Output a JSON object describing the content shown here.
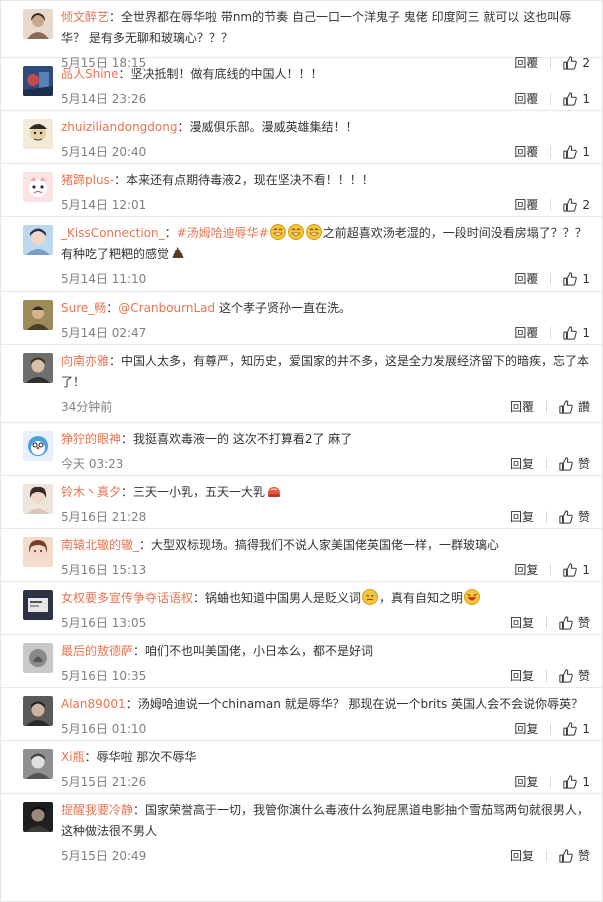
{
  "comments": [
    {
      "user": "倾文醉艺",
      "text": "：全世界都在辱华啦 带nm的节奏  自己一口一个洋鬼子 鬼佬 印度阿三 就可以 这也叫辱华？ 是有多无聊和玻璃心？？？",
      "time": "5月15日 18:15",
      "reply": "回覆",
      "likes": "2",
      "avatar_color": "#c9a78f"
    },
    {
      "user": "品人Shine",
      "text": "：坚决抵制！做有底线的中国人！！！",
      "time": "5月14日 23:26",
      "reply": "回覆",
      "likes": "1",
      "avatar_color": "#4a6fa5"
    },
    {
      "user": "zhuiziliandongdong",
      "text": "：漫威俱乐部。漫威英雄集结！！",
      "time": "5月14日 20:40",
      "reply": "回覆",
      "likes": "1",
      "avatar_color": "#e8d7b8"
    },
    {
      "user": "猪蹄plus-",
      "text": "：本来还有点期待毒液2，现在坚决不看！！！！",
      "time": "5月14日 12:01",
      "reply": "回覆",
      "likes": "2",
      "avatar_color": "#f2c6c6"
    },
    {
      "user": "_KissConnection_",
      "mention": "#汤姆哈迪辱华#",
      "text_after": "之前超喜欢汤老湿的，一段时间没看房塌了？？？有种吃了粑粑的感觉",
      "time": "5月14日 11:10",
      "reply": "回覆",
      "likes": "1",
      "avatar_color": "#8fb6d9"
    },
    {
      "user": "Sure_畅",
      "mention": "@CranbournLad",
      "text_after": " 这个孝子贤孙一直在洗。",
      "time": "5月14日 02:47",
      "reply": "回覆",
      "likes": "1",
      "avatar_color": "#8a7a4c"
    },
    {
      "user": "向南亦雅",
      "text": "：中国人太多，有尊严，知历史，爱国家的并不多，这是全力发展经济留下的暗疾，忘了本了！",
      "time": "34分钟前",
      "reply": "回覆",
      "likes": "讚",
      "avatar_color": "#6b6b6b"
    },
    {
      "user": "狰狞的眼神",
      "text": "：我挺喜欢毒液一的  这次不打算看2了  麻了",
      "time": "今天 03:23",
      "reply": "回复",
      "likes": "赞",
      "avatar_color": "#5fa0d8"
    },
    {
      "user": "铃木丶真夕",
      "text": "：三天一小乳，五天一大乳",
      "time": "5月16日 21:28",
      "reply": "回复",
      "likes": "赞",
      "avatar_color": "#d9c2b0"
    },
    {
      "user": "南辕北辙的辙_",
      "text": "：大型双标现场。搞得我们不说人家美国佬英国佬一样，一群玻璃心",
      "time": "5月16日 15:13",
      "reply": "回复",
      "likes": "1",
      "avatar_color": "#c98b6a"
    },
    {
      "user": "女权要多宣传争夺话语权",
      "text": "：锅蛐也知道中国男人是贬义词",
      "text_after": "，真有自知之明",
      "time": "5月16日 13:05",
      "reply": "回复",
      "likes": "赞",
      "avatar_color": "#3a3f55"
    },
    {
      "user": "最后的敖德萨",
      "text": "：咱们不也叫美国佬，小日本么，都不是好词",
      "time": "5月16日 10:35",
      "reply": "回复",
      "likes": "赞",
      "avatar_color": "#9a9a9a"
    },
    {
      "user": "Alan89001",
      "text": "：汤姆哈迪说一个chinaman 就是辱华？ 那现在说一个brits 英国人会不会说你辱英？",
      "time": "5月16日 01:10",
      "reply": "回复",
      "likes": "1",
      "avatar_color": "#4b4b4b"
    },
    {
      "user": "Xi瓶",
      "text": "：辱华啦 那次不辱华",
      "time": "5月15日 21:26",
      "reply": "回复",
      "likes": "1",
      "avatar_color": "#7a7a7a"
    },
    {
      "user": "提醒我要冷静",
      "text": "：国家荣誉高于一切，我管你演什么毒液什么狗屁黑道电影抽个雪茄骂两句就很男人，这种做法很不男人",
      "time": "5月15日 20:49",
      "reply": "回复",
      "likes": "赞",
      "avatar_color": "#2e2e2e"
    }
  ],
  "colors": {
    "username": "#eb7350",
    "meta": "#808080",
    "border": "#eaeaea"
  },
  "icons": {
    "like": "thumbs-up-icon",
    "emoji": "grinning-emoji-icon",
    "poop": "poop-emoji-icon",
    "sweat": "sweat-emoji-icon",
    "laugh": "laugh-emoji-icon",
    "bun": "bun-emoji-icon"
  }
}
